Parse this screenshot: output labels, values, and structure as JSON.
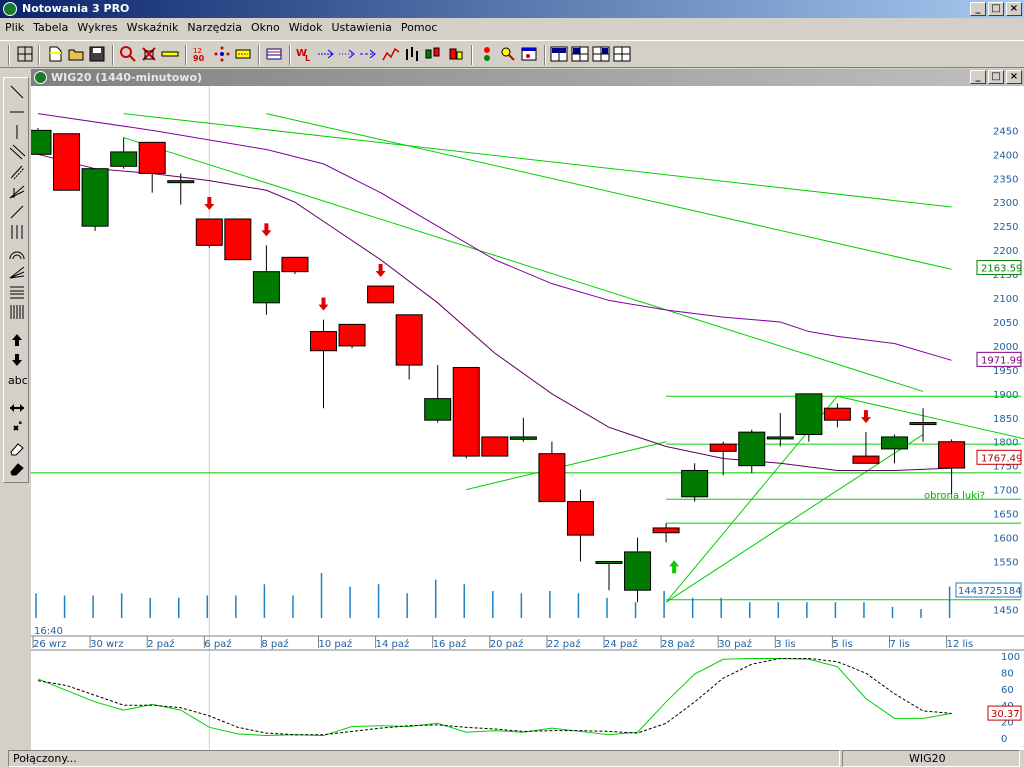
{
  "app": {
    "title": "Notowania 3 PRO",
    "min_label": "_",
    "max_label": "□",
    "close_label": "×"
  },
  "menu": [
    "Plik",
    "Tabela",
    "Wykres",
    "Wskaźnik",
    "Narzędzia",
    "Okno",
    "Widok",
    "Ustawienia",
    "Pomoc"
  ],
  "toolbar_icons": [
    "grid-icon",
    "new-file-icon",
    "open-folder-icon",
    "save-icon",
    "zoom-icon",
    "delete-icon",
    "ruler-icon",
    "numbers-icon",
    "points-icon",
    "line-style-icon",
    "table-icon",
    "wl-icon",
    "arrow-right-icon",
    "arrow-right-dotted-icon",
    "arrow-right-dashed-icon",
    "line-chart-icon",
    "bar-chart-icon",
    "candle-chart-icon",
    "traffic-light-icon",
    "magnify-plus-icon",
    "window-icon",
    "layout-1-icon",
    "layout-2-icon",
    "layout-3-icon",
    "layout-4-icon"
  ],
  "left_tools": [
    "diagonal-line-icon",
    "horizontal-line-icon",
    "vertical-line-icon",
    "parallel-lines-icon",
    "channel-icon",
    "fan-icon",
    "segment-icon",
    "vertical-lines-icon",
    "arcs-icon",
    "fan-lines-icon",
    "fibonacci-icon",
    "cycles-icon",
    "buy-arrow-icon",
    "sell-arrow-icon",
    "text-icon",
    "resize-icon",
    "cross-icon",
    "eraser-icon",
    "eraser-all-icon"
  ],
  "left_tools_text_label": "abc",
  "chart_window": {
    "title": "WIG20 (1440-minutowo)"
  },
  "chart_data": {
    "type": "candlestick",
    "y_ticks": [
      2450,
      2400,
      2350,
      2300,
      2250,
      2200,
      2150,
      2100,
      2050,
      2000,
      1950,
      1900,
      1850,
      1800,
      1750,
      1700,
      1650,
      1600,
      1550,
      1450
    ],
    "ylim": [
      1432,
      2480
    ],
    "x_labels": [
      {
        "label": "26 wrz",
        "x": 0
      },
      {
        "label": "30 wrz",
        "x": 2
      },
      {
        "label": "2 paź",
        "x": 4
      },
      {
        "label": "6 paź",
        "x": 6
      },
      {
        "label": "8 paź",
        "x": 8
      },
      {
        "label": "10 paź",
        "x": 10
      },
      {
        "label": "14 paź",
        "x": 12
      },
      {
        "label": "16 paź",
        "x": 14
      },
      {
        "label": "20 paź",
        "x": 16
      },
      {
        "label": "22 paź",
        "x": 18
      },
      {
        "label": "24 paź",
        "x": 20
      },
      {
        "label": "28 paź",
        "x": 22
      },
      {
        "label": "30 paź",
        "x": 24
      },
      {
        "label": "3 lis",
        "x": 26
      },
      {
        "label": "5 lis",
        "x": 28
      },
      {
        "label": "7 lis",
        "x": 30
      },
      {
        "label": "12 lis",
        "x": 32
      }
    ],
    "time_label": "16:40",
    "candles": [
      {
        "o": 2400,
        "h": 2455,
        "l": 2400,
        "c": 2450
      },
      {
        "o": 2443,
        "h": 2443,
        "l": 2325,
        "c": 2325
      },
      {
        "o": 2250,
        "h": 2365,
        "l": 2240,
        "c": 2370
      },
      {
        "o": 2375,
        "h": 2435,
        "l": 2370,
        "c": 2405
      },
      {
        "o": 2425,
        "h": 2425,
        "l": 2320,
        "c": 2360
      },
      {
        "o": 2345,
        "h": 2360,
        "l": 2295,
        "c": 2345
      },
      {
        "o": 2265,
        "h": 2265,
        "l": 2205,
        "c": 2210
      },
      {
        "o": 2265,
        "h": 2265,
        "l": 2180,
        "c": 2180
      },
      {
        "o": 2090,
        "h": 2210,
        "l": 2065,
        "c": 2155
      },
      {
        "o": 2185,
        "h": 2185,
        "l": 2150,
        "c": 2155
      },
      {
        "o": 2030,
        "h": 2055,
        "l": 1870,
        "c": 1990
      },
      {
        "o": 2045,
        "h": 2045,
        "l": 1995,
        "c": 2000
      },
      {
        "o": 2125,
        "h": 2125,
        "l": 2090,
        "c": 2090
      },
      {
        "o": 2065,
        "h": 2065,
        "l": 1930,
        "c": 1960
      },
      {
        "o": 1845,
        "h": 1960,
        "l": 1840,
        "c": 1890
      },
      {
        "o": 1955,
        "h": 1955,
        "l": 1765,
        "c": 1770
      },
      {
        "o": 1810,
        "h": 1810,
        "l": 1770,
        "c": 1770
      },
      {
        "o": 1805,
        "h": 1850,
        "l": 1800,
        "c": 1810
      },
      {
        "o": 1775,
        "h": 1800,
        "l": 1675,
        "c": 1675
      },
      {
        "o": 1675,
        "h": 1700,
        "l": 1550,
        "c": 1605
      },
      {
        "o": 1550,
        "h": 1550,
        "l": 1490,
        "c": 1550
      },
      {
        "o": 1490,
        "h": 1600,
        "l": 1465,
        "c": 1570
      },
      {
        "o": 1620,
        "h": 1630,
        "l": 1590,
        "c": 1610
      },
      {
        "o": 1685,
        "h": 1755,
        "l": 1675,
        "c": 1740
      },
      {
        "o": 1795,
        "h": 1800,
        "l": 1730,
        "c": 1780
      },
      {
        "o": 1750,
        "h": 1825,
        "l": 1735,
        "c": 1820
      },
      {
        "o": 1810,
        "h": 1860,
        "l": 1790,
        "c": 1810
      },
      {
        "o": 1815,
        "h": 1900,
        "l": 1800,
        "c": 1900
      },
      {
        "o": 1870,
        "h": 1880,
        "l": 1830,
        "c": 1845
      },
      {
        "o": 1770,
        "h": 1820,
        "l": 1760,
        "c": 1755
      },
      {
        "o": 1785,
        "h": 1815,
        "l": 1755,
        "c": 1810
      },
      {
        "o": 1840,
        "h": 1870,
        "l": 1800,
        "c": 1840
      },
      {
        "o": 1800,
        "h": 1805,
        "l": 1690,
        "c": 1745
      }
    ],
    "ma_fast": [
      [
        0,
        2400
      ],
      [
        2,
        2370
      ],
      [
        4,
        2360
      ],
      [
        6,
        2345
      ],
      [
        8,
        2325
      ],
      [
        9,
        2300
      ],
      [
        10,
        2260
      ],
      [
        12,
        2180
      ],
      [
        14,
        2090
      ],
      [
        16,
        1985
      ],
      [
        18,
        1900
      ],
      [
        20,
        1830
      ],
      [
        22,
        1790
      ],
      [
        24,
        1765
      ],
      [
        26,
        1755
      ],
      [
        28,
        1740
      ],
      [
        30,
        1740
      ],
      [
        32,
        1745
      ]
    ],
    "ma_slow": [
      [
        0,
        2485
      ],
      [
        4,
        2450
      ],
      [
        8,
        2410
      ],
      [
        10,
        2380
      ],
      [
        12,
        2320
      ],
      [
        14,
        2250
      ],
      [
        16,
        2180
      ],
      [
        18,
        2130
      ],
      [
        20,
        2095
      ],
      [
        22,
        2075
      ],
      [
        24,
        2060
      ],
      [
        26,
        2050
      ],
      [
        27,
        2030
      ],
      [
        28,
        2020
      ],
      [
        30,
        2005
      ],
      [
        32,
        1970
      ]
    ],
    "trend_lines": [
      [
        [
          3,
          2485
        ],
        [
          32,
          2290
        ]
      ],
      [
        [
          8,
          2485
        ],
        [
          32,
          2160
        ]
      ],
      [
        [
          3,
          2435
        ],
        [
          31,
          1905
        ]
      ],
      [
        [
          15,
          1700
        ],
        [
          22,
          1800
        ]
      ],
      [
        [
          22,
          1465
        ],
        [
          28,
          1895
        ]
      ],
      [
        [
          22,
          1465
        ],
        [
          31,
          1815
        ]
      ],
      [
        [
          28,
          1895
        ],
        [
          35,
          1800
        ]
      ]
    ],
    "levels": [
      {
        "y": 1895,
        "x0": 22
      },
      {
        "y": 1795,
        "x0": 22
      },
      {
        "y": 1735,
        "x0": -1
      },
      {
        "y": 1680,
        "x0": 22
      },
      {
        "y": 1630,
        "x0": 22
      },
      {
        "y": 1470,
        "x0": 22
      }
    ],
    "sell_signals": [
      6,
      8,
      10,
      12,
      29
    ],
    "buy_signals": [
      21
    ],
    "annotation": "obrona luki?",
    "price_labels": [
      {
        "value": "2163.59",
        "y": 2163.59,
        "color": "#008000"
      },
      {
        "value": "1971.99",
        "y": 1971.99,
        "color": "#800080"
      },
      {
        "value": "1767.49",
        "y": 1767.49,
        "color": "#c00000"
      }
    ],
    "volume": [
      0.55,
      0.5,
      0.5,
      0.55,
      0.45,
      0.45,
      0.5,
      0.5,
      0.75,
      0.5,
      1.0,
      0.7,
      0.75,
      0.55,
      0.85,
      0.75,
      0.6,
      0.55,
      0.6,
      0.55,
      0.45,
      0.35,
      0.6,
      0.45,
      0.45,
      0.35,
      0.35,
      0.35,
      0.35,
      0.35,
      0.25,
      0.2,
      0.7
    ],
    "volume_label": "1443725184",
    "osc_ticks": [
      100,
      80,
      60,
      40,
      20,
      0
    ],
    "osc_k": [
      [
        0,
        72
      ],
      [
        1,
        58
      ],
      [
        2,
        44
      ],
      [
        3,
        34
      ],
      [
        4,
        41
      ],
      [
        5,
        34
      ],
      [
        6,
        13
      ],
      [
        7,
        5
      ],
      [
        8,
        3
      ],
      [
        9,
        4
      ],
      [
        10,
        3
      ],
      [
        11,
        14
      ],
      [
        12,
        15
      ],
      [
        13,
        14
      ],
      [
        14,
        18
      ],
      [
        15,
        7
      ],
      [
        16,
        9
      ],
      [
        17,
        7
      ],
      [
        18,
        12
      ],
      [
        19,
        8
      ],
      [
        20,
        4
      ],
      [
        21,
        7
      ],
      [
        22,
        44
      ],
      [
        23,
        78
      ],
      [
        24,
        96
      ],
      [
        25,
        97
      ],
      [
        26,
        97
      ],
      [
        27,
        96
      ],
      [
        28,
        87
      ],
      [
        29,
        48
      ],
      [
        30,
        24
      ],
      [
        31,
        24
      ],
      [
        32,
        30
      ]
    ],
    "osc_d": [
      [
        0,
        70
      ],
      [
        1,
        64
      ],
      [
        2,
        52
      ],
      [
        3,
        40
      ],
      [
        4,
        40
      ],
      [
        5,
        37
      ],
      [
        6,
        27
      ],
      [
        7,
        13
      ],
      [
        8,
        6
      ],
      [
        9,
        4
      ],
      [
        10,
        4
      ],
      [
        11,
        8
      ],
      [
        12,
        12
      ],
      [
        13,
        15
      ],
      [
        14,
        16
      ],
      [
        15,
        13
      ],
      [
        16,
        11
      ],
      [
        17,
        8
      ],
      [
        18,
        9
      ],
      [
        19,
        9
      ],
      [
        20,
        8
      ],
      [
        21,
        6
      ],
      [
        22,
        18
      ],
      [
        23,
        44
      ],
      [
        24,
        73
      ],
      [
        25,
        90
      ],
      [
        26,
        97
      ],
      [
        27,
        97
      ],
      [
        28,
        93
      ],
      [
        29,
        79
      ],
      [
        30,
        54
      ],
      [
        31,
        33
      ],
      [
        32,
        30
      ]
    ],
    "osc_label": "30.37"
  },
  "status": {
    "connection": "Połączony...",
    "symbol": "WIG20"
  }
}
